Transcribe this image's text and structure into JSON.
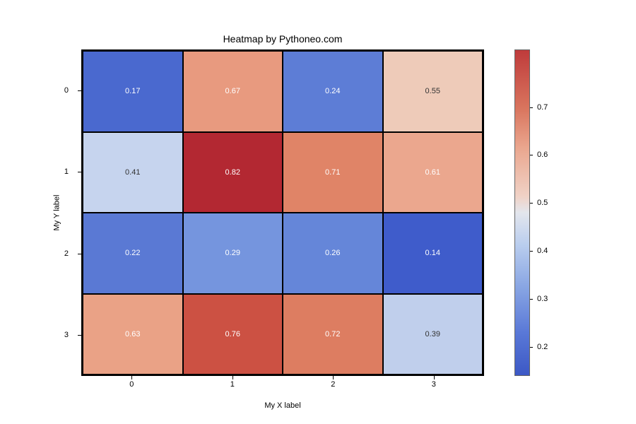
{
  "chart_data": {
    "type": "heatmap",
    "title": "Heatmap by Pythoneo.com",
    "xlabel": "My X label",
    "ylabel": "My Y label",
    "x_categories": [
      "0",
      "1",
      "2",
      "3"
    ],
    "y_categories": [
      "0",
      "1",
      "2",
      "3"
    ],
    "values": [
      [
        0.17,
        0.67,
        0.24,
        0.55
      ],
      [
        0.41,
        0.82,
        0.71,
        0.61
      ],
      [
        0.22,
        0.29,
        0.26,
        0.14
      ],
      [
        0.63,
        0.76,
        0.72,
        0.39
      ]
    ],
    "cell_labels": [
      [
        "0.17",
        "0.67",
        "0.24",
        "0.55"
      ],
      [
        "0.41",
        "0.82",
        "0.71",
        "0.61"
      ],
      [
        "0.22",
        "0.29",
        "0.26",
        "0.14"
      ],
      [
        "0.63",
        "0.76",
        "0.72",
        "0.39"
      ]
    ],
    "cell_colors": [
      [
        "#4a69cf",
        "#e89a7f",
        "#5d7dd6",
        "#eecbb9"
      ],
      [
        "#c6d4ee",
        "#b32832",
        "#e08467",
        "#eba78e"
      ],
      [
        "#5a79d4",
        "#7595de",
        "#6586d9",
        "#3f5ccb"
      ],
      [
        "#eaa286",
        "#cc5143",
        "#dd7d61",
        "#c0cfec"
      ]
    ],
    "cell_text_dark": [
      [
        false,
        false,
        false,
        true
      ],
      [
        true,
        false,
        false,
        false
      ],
      [
        false,
        false,
        false,
        false
      ],
      [
        false,
        false,
        false,
        true
      ]
    ],
    "colorbar_ticks": [
      "0.2",
      "0.3",
      "0.4",
      "0.5",
      "0.6",
      "0.7"
    ],
    "vmin": 0.14,
    "vmax": 0.82
  }
}
